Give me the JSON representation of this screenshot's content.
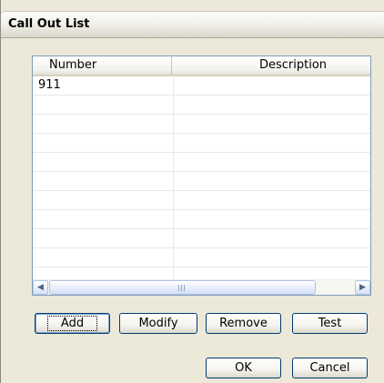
{
  "window": {
    "title": "Call Out List"
  },
  "list": {
    "columns": [
      "Number",
      "Description"
    ],
    "rows": [
      {
        "number": "911",
        "description": ""
      }
    ]
  },
  "scrollbar": {
    "left_glyph": "◀",
    "right_glyph": "▶",
    "grip": "III"
  },
  "buttons": {
    "add": "Add",
    "modify": "Modify",
    "remove": "Remove",
    "test": "Test",
    "ok": "OK",
    "cancel": "Cancel"
  }
}
